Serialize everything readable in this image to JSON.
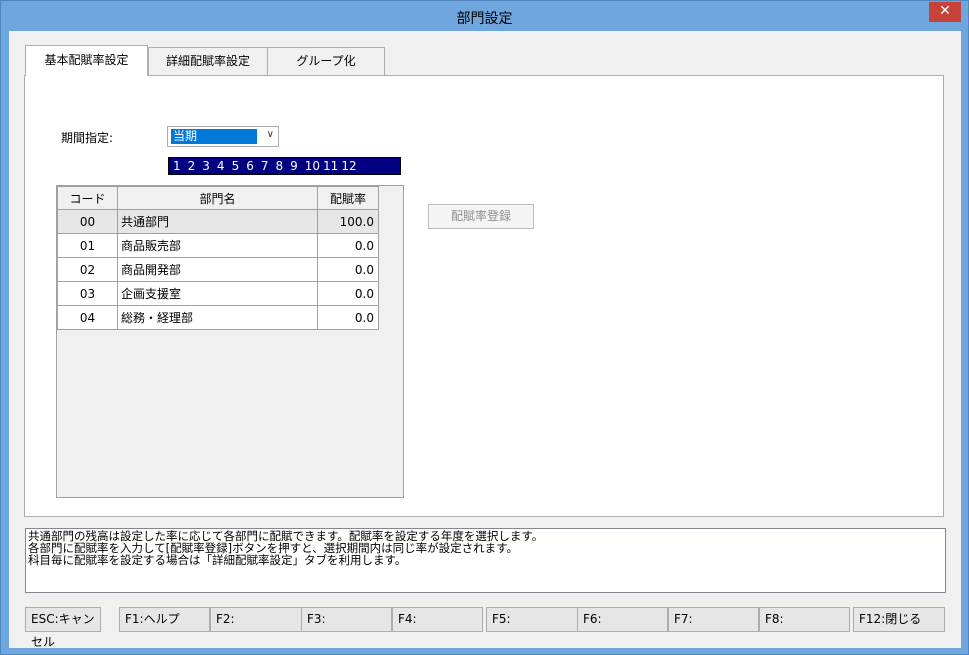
{
  "window": {
    "title": "部門設定",
    "close_label": "✕"
  },
  "tabs": [
    {
      "label": "基本配賦率設定",
      "active": true
    },
    {
      "label": "詳細配賦率設定",
      "active": false
    },
    {
      "label": "グループ化",
      "active": false
    }
  ],
  "period": {
    "label": "期間指定:",
    "value": "当期"
  },
  "months": [
    "1",
    "2",
    "3",
    "4",
    "5",
    "6",
    "7",
    "8",
    "9",
    "10",
    "11",
    "12"
  ],
  "table": {
    "headers": [
      "コード",
      "部門名",
      "配賦率"
    ],
    "rows": [
      {
        "code": "00",
        "name": "共通部門",
        "rate": "100.0"
      },
      {
        "code": "01",
        "name": "商品販売部",
        "rate": "0.0"
      },
      {
        "code": "02",
        "name": "商品開発部",
        "rate": "0.0"
      },
      {
        "code": "03",
        "name": "企画支援室",
        "rate": "0.0"
      },
      {
        "code": "04",
        "name": "総務・経理部",
        "rate": "0.0"
      }
    ]
  },
  "register_button": "配賦率登録",
  "help_lines": [
    "共通部門の残高は設定した率に応じて各部門に配賦できます。配賦率を設定する年度を選択します。",
    "各部門に配賦率を入力して[配賦率登録]ボタンを押すと、選択期間内は同じ率が設定されます。",
    "科目毎に配賦率を設定する場合は「詳細配賦率設定」タブを利用します。"
  ],
  "function_keys": [
    "ESC:キャンセル",
    "F1:ヘルプ",
    "F2:",
    "F3:",
    "F4:",
    "F5:",
    "F6:",
    "F7:",
    "F8:",
    "F12:閉じる"
  ]
}
